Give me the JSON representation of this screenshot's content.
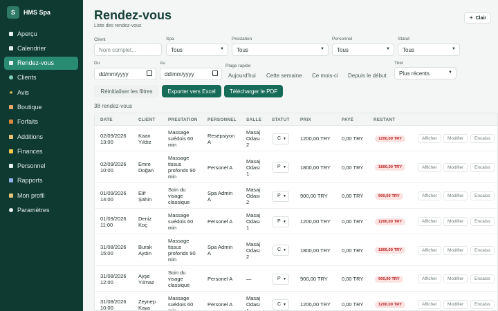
{
  "brand": {
    "logo": "S",
    "name": "HMS Spa"
  },
  "nav": [
    {
      "label": "Aperçu",
      "icon": "overview-icon"
    },
    {
      "label": "Calendrier",
      "icon": "calendar-icon"
    },
    {
      "label": "Rendez-vous",
      "icon": "appointments-icon",
      "active": true
    },
    {
      "label": "Clients",
      "icon": "clients-icon"
    },
    {
      "label": "Avis",
      "icon": "star-icon"
    },
    {
      "label": "Boutique",
      "icon": "shop-icon"
    },
    {
      "label": "Forfaits",
      "icon": "package-icon"
    },
    {
      "label": "Additions",
      "icon": "additions-icon"
    },
    {
      "label": "Finances",
      "icon": "finance-icon"
    },
    {
      "label": "Personnel",
      "icon": "staff-icon"
    },
    {
      "label": "Rapports",
      "icon": "reports-icon"
    },
    {
      "label": "Mon profil",
      "icon": "profile-icon"
    },
    {
      "label": "Paramètres",
      "icon": "settings-icon"
    }
  ],
  "header": {
    "title": "Rendez-vous",
    "subtitle": "Liste des rendez-vous",
    "theme_label": "Clair",
    "theme_icon": "☀"
  },
  "filters": {
    "client_label": "Client",
    "client_placeholder": "Nom complet...",
    "spa_label": "Spa",
    "spa_value": "Tous",
    "service_label": "Prestation",
    "service_value": "Tous",
    "staff_label": "Personnel",
    "staff_value": "Tous",
    "status_label": "Statut",
    "status_value": "Tous",
    "from_label": "Du",
    "from_value": "dd/mm/yyyy",
    "to_label": "Au",
    "to_value": "dd/mm/yyyy",
    "quick_label": "Plage rapide",
    "quick": [
      "Aujourd'hui",
      "Cette semaine",
      "Ce mois-ci",
      "Depuis le début"
    ],
    "sort_label": "Trier",
    "sort_value": "Plus récents"
  },
  "buttons": {
    "reset": "Réinitialiser les filtres",
    "excel": "Exporter vers Excel",
    "pdf": "Télécharger le PDF"
  },
  "count": "38 rendez-vous",
  "table": {
    "headers": [
      "DATE",
      "CLIENT",
      "PRESTATION",
      "PERSONNEL",
      "SALLE",
      "STATUT",
      "PRIX",
      "PAYÉ",
      "RESTANT"
    ],
    "actions": [
      "Afficher",
      "Modifier",
      "Encaiss"
    ],
    "rows": [
      {
        "date": [
          "02/09/2026",
          "13:00"
        ],
        "client": [
          "Kaan",
          "Yıldız"
        ],
        "service": [
          "Massage",
          "suédois 60",
          "min"
        ],
        "staff": [
          "Resepsiyon",
          "A"
        ],
        "salle": [
          "Masaj",
          "Odası",
          "2"
        ],
        "status": "C",
        "prix": "1200,00 TRY",
        "paye": "0,00 TRY",
        "restant": "1200,00 TRY"
      },
      {
        "date": [
          "02/09/2026",
          "10:00"
        ],
        "client": [
          "Emre",
          "Doğan"
        ],
        "service": [
          "Massage",
          "tissus",
          "profonds 90",
          "min"
        ],
        "staff": [
          "Personel A"
        ],
        "salle": [
          "Masaj",
          "Odası",
          "1"
        ],
        "status": "P",
        "prix": "1800,00 TRY",
        "paye": "0,00 TRY",
        "restant": "1800,00 TRY"
      },
      {
        "date": [
          "01/09/2026",
          "14:00"
        ],
        "client": [
          "Elif",
          "Şahin"
        ],
        "service": [
          "Soin du",
          "visage",
          "classique"
        ],
        "staff": [
          "Spa Admin",
          "A"
        ],
        "salle": [
          "Masaj",
          "Odası",
          "2"
        ],
        "status": "P",
        "prix": "900,00 TRY",
        "paye": "0,00 TRY",
        "restant": "900,00 TRY"
      },
      {
        "date": [
          "01/09/2026",
          "11:00"
        ],
        "client": [
          "Deniz",
          "Koç"
        ],
        "service": [
          "Massage",
          "suédois 60",
          "min"
        ],
        "staff": [
          "Personel A"
        ],
        "salle": [
          "Masaj",
          "Odası",
          "1"
        ],
        "status": "P",
        "prix": "1200,00 TRY",
        "paye": "0,00 TRY",
        "restant": "1200,00 TRY"
      },
      {
        "date": [
          "31/08/2026",
          "15:00"
        ],
        "client": [
          "Burak",
          "Aydın"
        ],
        "service": [
          "Massage",
          "tissus",
          "profonds 90",
          "min"
        ],
        "staff": [
          "Spa Admin",
          "A"
        ],
        "salle": [
          "Masaj",
          "Odası",
          "2"
        ],
        "status": "C",
        "prix": "1800,00 TRY",
        "paye": "0,00 TRY",
        "restant": "1800,00 TRY"
      },
      {
        "date": [
          "31/08/2026",
          "12:00"
        ],
        "client": [
          "Ayşe",
          "Yılmaz"
        ],
        "service": [
          "Soin du",
          "visage",
          "classique"
        ],
        "staff": [
          "Personel A"
        ],
        "salle": [
          "—"
        ],
        "status": "P",
        "prix": "900,00 TRY",
        "paye": "0,00 TRY",
        "restant": "900,00 TRY"
      },
      {
        "date": [
          "31/08/2026",
          "10:00"
        ],
        "client": [
          "Zeynep",
          "Kaya"
        ],
        "service": [
          "Massage",
          "suédois 60",
          "min"
        ],
        "staff": [
          "Personel A"
        ],
        "salle": [
          "Masaj",
          "Odası",
          "1"
        ],
        "status": "C",
        "prix": "1200,00 TRY",
        "paye": "0,00 TRY",
        "restant": "1200,00 TRY"
      }
    ]
  }
}
